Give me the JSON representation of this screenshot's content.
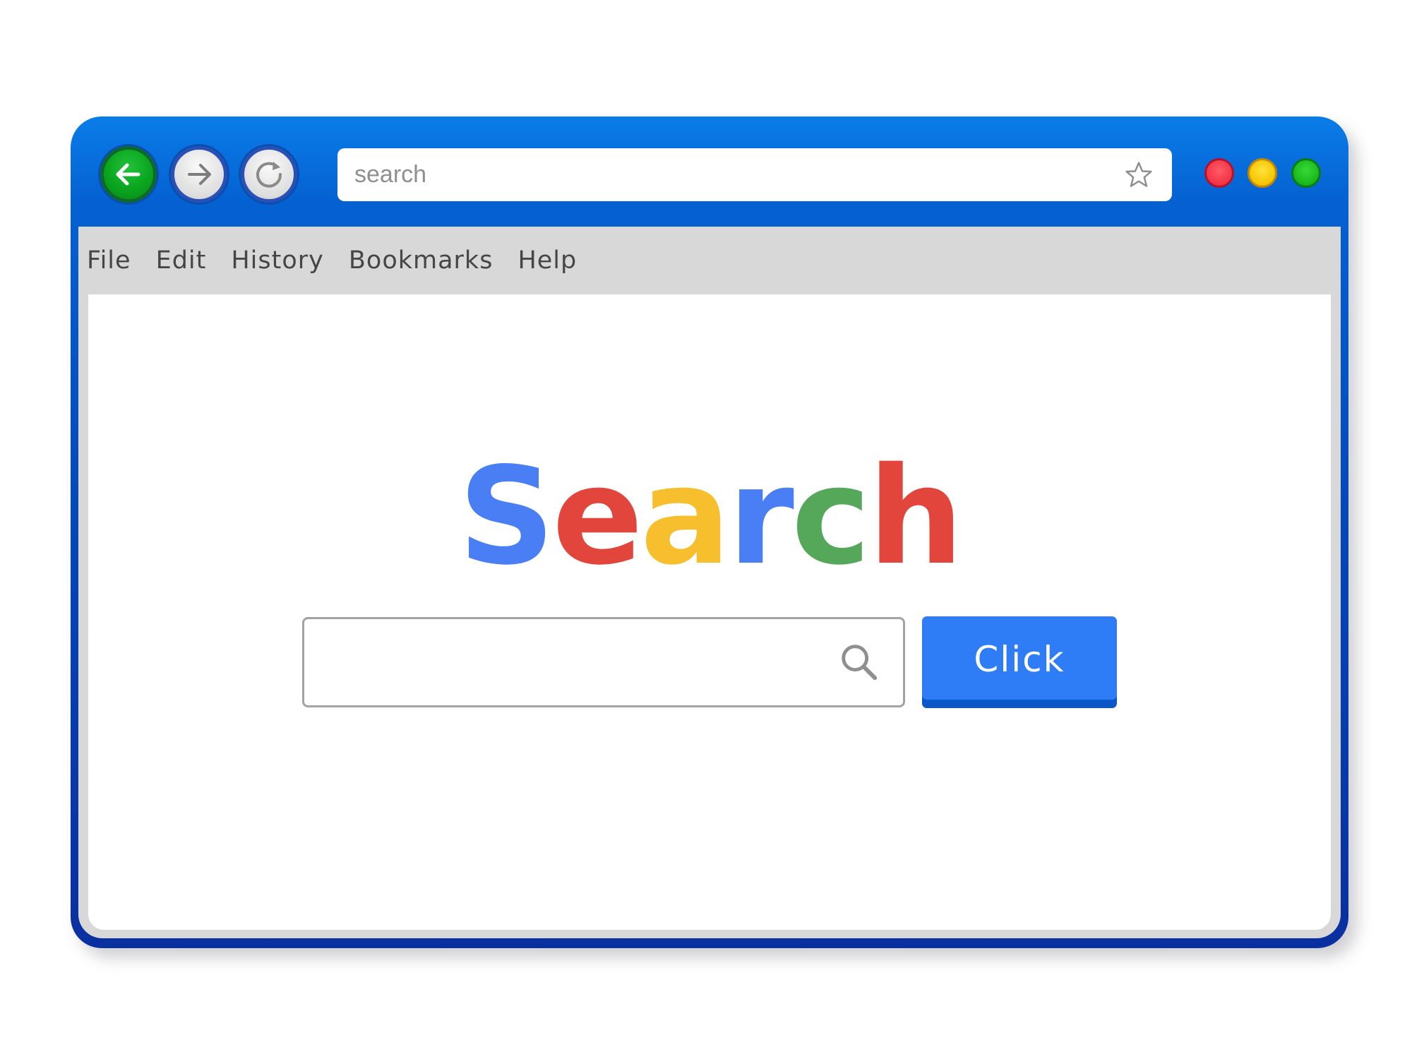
{
  "toolbar": {
    "back_icon": "arrow-left-icon",
    "forward_icon": "arrow-right-icon",
    "reload_icon": "reload-icon",
    "address_placeholder": "search",
    "bookmark_icon": "star-icon"
  },
  "window_controls": {
    "close_color": "#f23346",
    "minimize_color": "#f5c400",
    "maximize_color": "#17b81a"
  },
  "menu": {
    "items": [
      {
        "label": "File"
      },
      {
        "label": "Edit"
      },
      {
        "label": "History"
      },
      {
        "label": "Bookmarks"
      },
      {
        "label": "Help"
      }
    ]
  },
  "main": {
    "logo_letters": [
      {
        "char": "S",
        "color": "#4a7ef4"
      },
      {
        "char": "e",
        "color": "#e2453c"
      },
      {
        "char": "a",
        "color": "#f7be2e"
      },
      {
        "char": "r",
        "color": "#4a7ef4"
      },
      {
        "char": "c",
        "color": "#55a85a"
      },
      {
        "char": "h",
        "color": "#e2453c"
      }
    ],
    "search_value": "",
    "search_icon": "magnifier-icon",
    "button_label": "Click"
  },
  "colors": {
    "window_blue": "#0561d2",
    "menu_gray": "#d8d8d9",
    "button_blue": "#2e7cf6"
  }
}
